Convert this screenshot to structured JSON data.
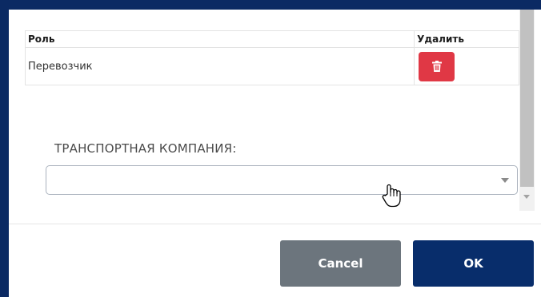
{
  "table": {
    "headers": {
      "role": "Роль",
      "delete": "Удалить"
    },
    "rows": [
      {
        "role": "Перевозчик"
      }
    ]
  },
  "form": {
    "company_label": "ТРАНСПОРТНАЯ КОМПАНИЯ:",
    "company_value": ""
  },
  "footer": {
    "cancel_label": "Cancel",
    "ok_label": "OK"
  },
  "icons": {
    "delete": "trash-icon",
    "select": "chevron-down-icon",
    "cursor": "hand-pointer-icon"
  },
  "colors": {
    "frame": "#0b2a63",
    "delete_button": "#e03845",
    "cancel_button": "#6c757d",
    "ok_button": "#082d6b"
  }
}
